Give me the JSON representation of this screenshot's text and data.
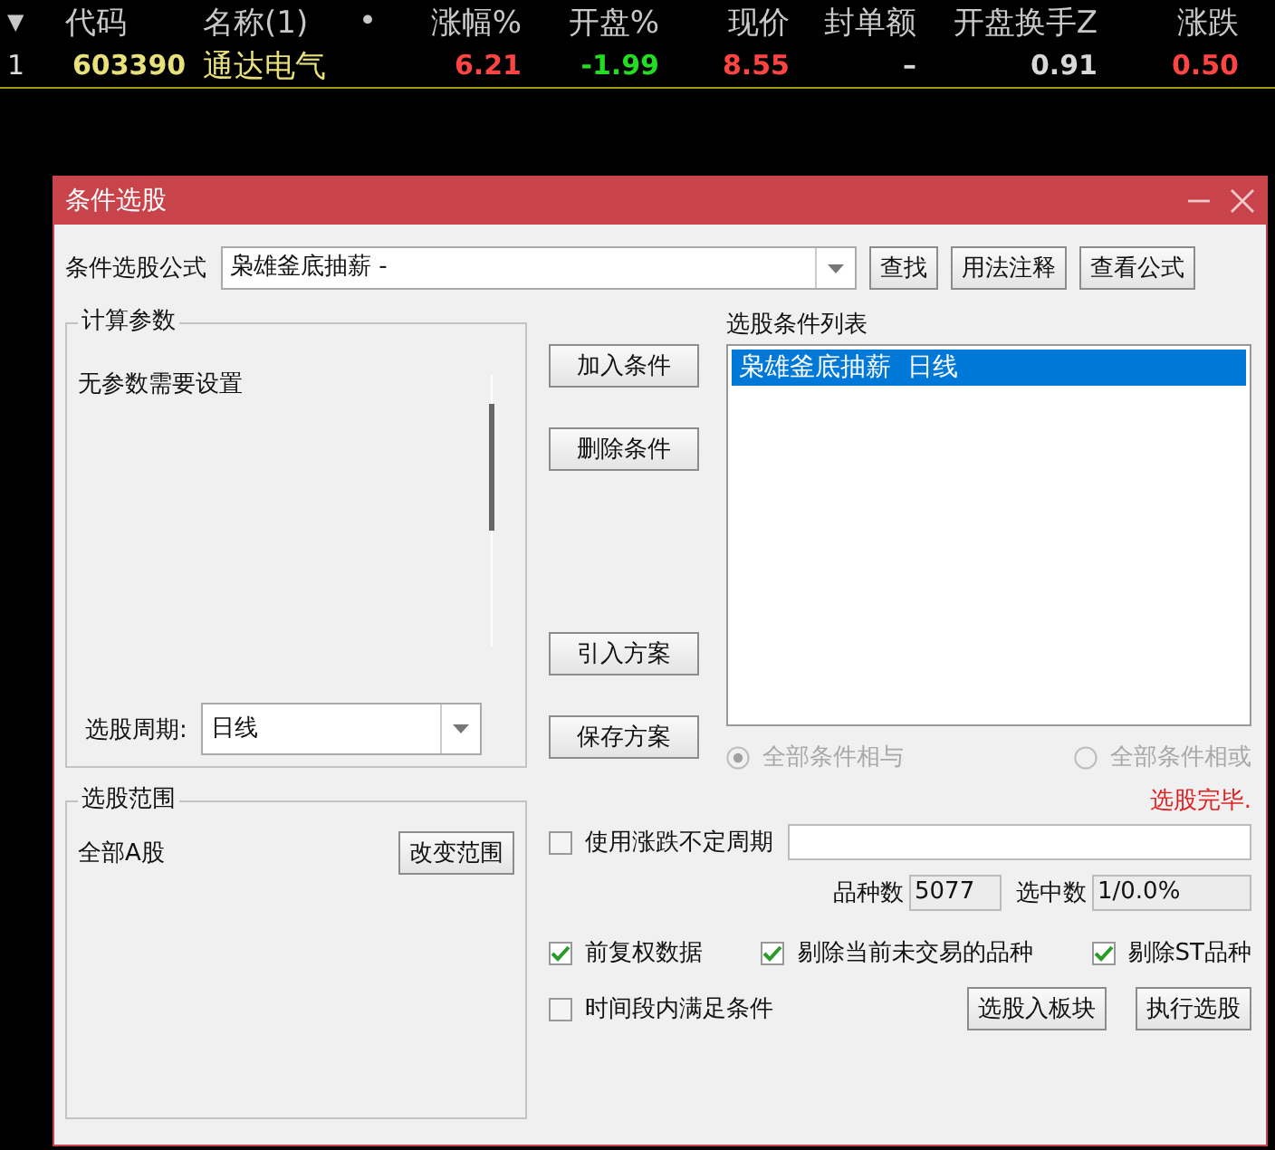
{
  "quote_table": {
    "columns": [
      "▼",
      "代码",
      "名称(1)",
      "•",
      "涨幅%",
      "开盘%",
      "现价",
      "封单额",
      "开盘换手Z",
      "涨跌"
    ],
    "rows": [
      {
        "cells": [
          {
            "text": "1",
            "kind": "index"
          },
          {
            "text": "603390",
            "kind": "code"
          },
          {
            "text": "通达电气",
            "kind": "name"
          },
          {
            "text": "",
            "kind": "empty"
          },
          {
            "text": "6.21",
            "kind": "up"
          },
          {
            "text": "-1.99",
            "kind": "down"
          },
          {
            "text": "8.55",
            "kind": "up"
          },
          {
            "text": "–",
            "kind": "flat"
          },
          {
            "text": "0.91",
            "kind": "flat"
          },
          {
            "text": "0.50",
            "kind": "up"
          }
        ]
      }
    ]
  },
  "dialog": {
    "title": "条件选股",
    "formula": {
      "label": "条件选股公式",
      "value": "枭雄釜底抽薪 -"
    },
    "top_buttons": [
      "查找",
      "用法注释",
      "查看公式"
    ],
    "params_group": {
      "title": "计算参数",
      "message": "无参数需要设置",
      "period_label": "选股周期:",
      "period_value": "日线"
    },
    "range_group": {
      "title": "选股范围",
      "value": "全部A股",
      "button": "改变范围"
    },
    "condition_buttons": [
      "加入条件",
      "删除条件"
    ],
    "plan_buttons": [
      "引入方案",
      "保存方案"
    ],
    "condition_list": {
      "label": "选股条件列表",
      "items": [
        {
          "text": "枭雄釜底抽薪  日线",
          "selected": true
        }
      ]
    },
    "logic_options": [
      {
        "label": "全部条件相与",
        "selected": true,
        "disabled": true
      },
      {
        "label": "全部条件相或",
        "selected": false,
        "disabled": true
      }
    ],
    "status": "选股完毕.",
    "variable_period": {
      "label": "使用涨跌不定周期",
      "checked": false
    },
    "counts": [
      {
        "label": "品种数",
        "value": "5077"
      },
      {
        "label": "选中数",
        "value": "1/0.0%"
      }
    ],
    "options": [
      {
        "label": "前复权数据",
        "checked": true
      },
      {
        "label": "剔除当前未交易的品种",
        "checked": true
      },
      {
        "label": "剔除ST品种",
        "checked": true
      }
    ],
    "time_range": {
      "label": "时间段内满足条件",
      "checked": false
    },
    "bottom_buttons": [
      "选股入板块",
      "执行选股"
    ]
  }
}
